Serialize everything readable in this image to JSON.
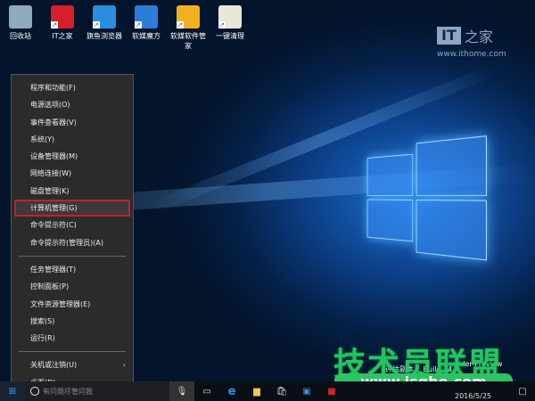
{
  "desktop_icons": [
    {
      "label": "回收站",
      "icon": "recycle-bin-icon",
      "color": "#8fa9bf"
    },
    {
      "label": "IT之家",
      "icon": "ithome-icon",
      "color": "#d3202a"
    },
    {
      "label": "旗鱼浏览器",
      "icon": "browser-icon",
      "color": "#2a8ee0"
    },
    {
      "label": "软媒魔方",
      "icon": "cube-icon",
      "color": "#2d7dd8"
    },
    {
      "label": "软媒软件管家",
      "icon": "software-manager-icon",
      "color": "#f0b020"
    },
    {
      "label": "一键清理",
      "icon": "cleanup-icon",
      "color": "#e8e8d8"
    }
  ],
  "ithome": {
    "logo_text": "IT之家",
    "logo_it": "IT",
    "logo_cn": "之家",
    "url": "www.ithome.com"
  },
  "menu": {
    "group1": [
      "程序和功能(F)",
      "电源选项(O)",
      "事件查看器(V)",
      "系统(Y)",
      "设备管理器(M)",
      "网络连接(W)",
      "磁盘管理(K)",
      "计算机管理(G)",
      "命令提示符(C)",
      "命令提示符(管理员)(A)"
    ],
    "group2": [
      "任务管理器(T)",
      "控制面板(P)",
      "文件资源管理器(E)",
      "搜索(S)",
      "运行(R)"
    ],
    "group3": [
      "关机或注销(U)",
      "桌面(D)"
    ],
    "selected": "计算机管理(G)",
    "highlight_color": "#c0222e"
  },
  "taskbar": {
    "search_placeholder": "有问题尽管问我",
    "date": "2016/5/25"
  },
  "version": {
    "line1": "sider Preview",
    "line2": "评估副本。 Build 14"
  },
  "watermark": {
    "title": "技术员联盟",
    "url": "www.jsgho.com"
  }
}
